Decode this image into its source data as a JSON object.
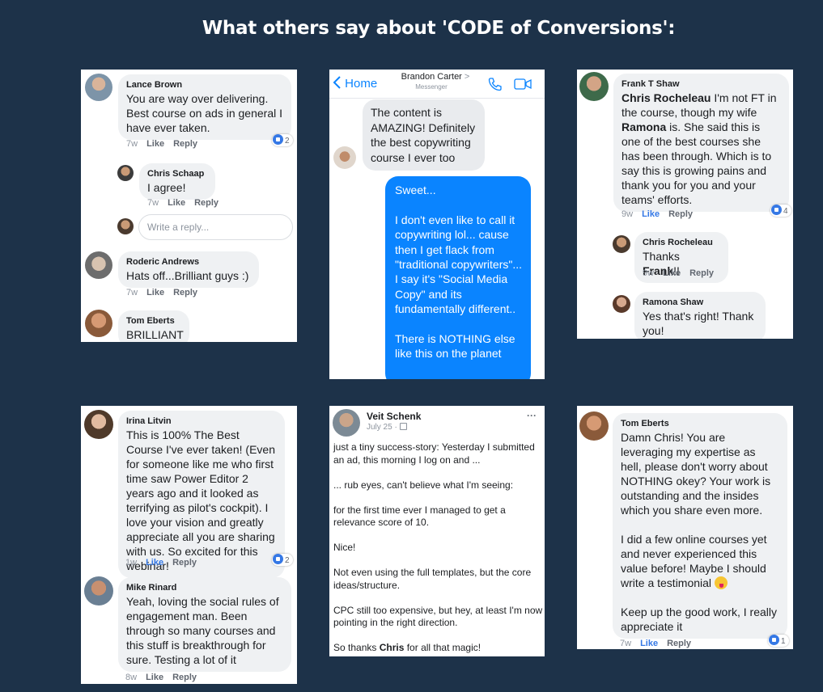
{
  "page": {
    "title": "What others say about 'CODE of Conversions':"
  },
  "card1": {
    "c1": {
      "name": "Lance Brown",
      "text": "You are way over delivering. Best course on ads in general I have ever taken.",
      "time": "7w",
      "like": "Like",
      "reply": "Reply",
      "reactions": "2"
    },
    "c2": {
      "name": "Chris Schaap",
      "text": "I agree!",
      "time": "7w",
      "like": "Like",
      "reply": "Reply"
    },
    "reply_placeholder": "Write a reply...",
    "c3": {
      "name": "Roderic Andrews",
      "text": "Hats off...Brilliant guys :)",
      "time": "7w",
      "like": "Like",
      "reply": "Reply"
    },
    "c4": {
      "name": "Tom Eberts",
      "text": "BRILLIANT"
    }
  },
  "card2": {
    "back_label": "Home",
    "contact_name": "Brandon Carter",
    "contact_chevron": ">",
    "contact_sub": "Messenger",
    "icons": [
      "chevron-left-icon",
      "phone-icon",
      "video-icon"
    ],
    "incoming": "The content is AMAZING! Definitely the best copywriting course I ever too",
    "outgoing": [
      "Sweet...",
      "I don't even like to call it copywriting lol... cause then I get flack from \"traditional copywriters\"... I say it's \"Social Media Copy\" and its fundamentally different..",
      "There is NOTHING else like this on the planet"
    ],
    "colors": {
      "accent": "#0a84ff",
      "incoming_bg": "#e9ebee"
    }
  },
  "card3": {
    "c1": {
      "name": "Frank T Shaw",
      "mention1": "Chris Rocheleau",
      "text1": " I'm not FT in the course, though my wife ",
      "mention2": "Ramona",
      "text2": " is. She said this is one of the best courses she has been through. Which is to say this is growing pains and thank you for you and your teams' efforts.",
      "time": "9w",
      "like": "Like",
      "reply": "Reply",
      "reactions": "4"
    },
    "c2": {
      "name": "Chris Rocheleau",
      "text1": "Thanks ",
      "mention": "Frank",
      "text2": "!!",
      "time": "9w",
      "like": "Like",
      "reply": "Reply"
    },
    "c3": {
      "name": "Ramona Shaw",
      "text": "Yes that's right! Thank you!"
    }
  },
  "card4": {
    "c1": {
      "name": "Irina Litvin",
      "text": "This is 100% The Best Course I've ever taken! (Even for someone like me who first time saw Power Editor 2 years ago and it looked as terrifying as pilot's cockpit). I love your vision and greatly appreciate all you are sharing with us. So excited for this webinar!",
      "time": "1w",
      "like": "Like",
      "reply": "Reply",
      "reactions": "2"
    },
    "c2": {
      "name": "Mike Rinard",
      "text": "Yeah, loving the social rules of engagement man.  Been through so many courses and this stuff is breakthrough for sure.  Testing a lot of it",
      "time": "8w",
      "like": "Like",
      "reply": "Reply"
    }
  },
  "card5": {
    "name": "Veit Schenk",
    "date": "July 25 ·",
    "more": "···",
    "p1": "just a tiny success-story: Yesterday I submitted an ad, this morning I log on and ...",
    "p2": "... rub eyes, can't believe what I'm seeing:",
    "p3": "for the first time ever I managed to get a relevance score of 10.",
    "p4": "Nice!",
    "p5": "Not even using the full templates, but the core ideas/structure.",
    "p6": "CPC still too expensive, but hey, at least I'm now pointing in the right direction.",
    "p7a": "So thanks ",
    "p7b": "Chris",
    "p7c": " for all that magic!"
  },
  "card6": {
    "c1": {
      "name": "Tom Eberts",
      "p1": "Damn Chris! You are leveraging my expertise as hell, please don't worry about NOTHING okey? Your work is outstanding and the insides which you share even more.",
      "p2": "I did a few online courses yet and never experienced this value before! Maybe I should write a testimonial",
      "emoji_icon": "tongue-face-emoji-icon",
      "p3": "Keep up the good work, I really appreciate it",
      "time": "7w",
      "like": "Like",
      "reply": "Reply",
      "reactions": "1"
    }
  }
}
